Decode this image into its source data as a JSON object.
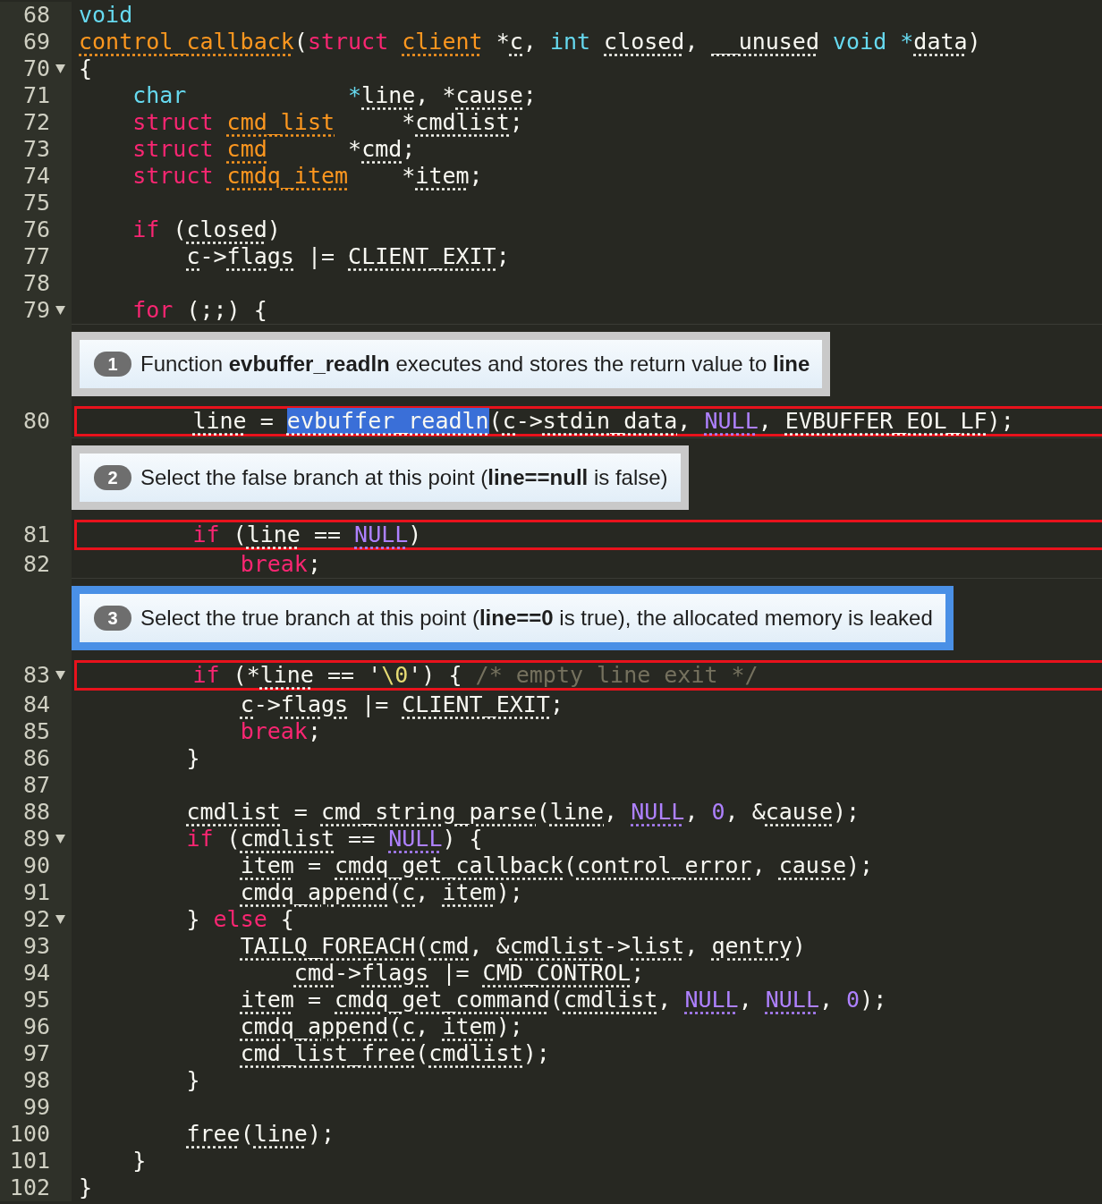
{
  "editor": {
    "lines": [
      {
        "kind": "code",
        "number": "68",
        "foldable": false,
        "marked": false,
        "tokens": [
          {
            "text": "void",
            "kind": "storage"
          }
        ]
      },
      {
        "kind": "code",
        "number": "69",
        "foldable": false,
        "marked": false,
        "tokens": [
          {
            "text": "control_callback",
            "kind": "fn"
          },
          {
            "text": "(",
            "kind": "plain"
          },
          {
            "text": "struct ",
            "kind": "kw"
          },
          {
            "text": "client",
            "kind": "type"
          },
          {
            "text": " *",
            "kind": "plain"
          },
          {
            "text": "c",
            "kind": "id"
          },
          {
            "text": ", ",
            "kind": "plain"
          },
          {
            "text": "int ",
            "kind": "storage"
          },
          {
            "text": "closed",
            "kind": "id"
          },
          {
            "text": ", ",
            "kind": "plain"
          },
          {
            "text": "__unused",
            "kind": "id"
          },
          {
            "text": " void *",
            "kind": "storage"
          },
          {
            "text": "data",
            "kind": "id"
          },
          {
            "text": ")",
            "kind": "plain"
          }
        ]
      },
      {
        "kind": "code",
        "number": "70",
        "foldable": true,
        "marked": false,
        "tokens": [
          {
            "text": "{",
            "kind": "plain"
          }
        ]
      },
      {
        "kind": "code",
        "number": "71",
        "foldable": false,
        "marked": false,
        "tokens": [
          {
            "text": "    char            *",
            "kind": "storage"
          },
          {
            "text": "line",
            "kind": "id"
          },
          {
            "text": ", *",
            "kind": "plain"
          },
          {
            "text": "cause",
            "kind": "id"
          },
          {
            "text": ";",
            "kind": "plain"
          }
        ]
      },
      {
        "kind": "code",
        "number": "72",
        "foldable": false,
        "marked": false,
        "tokens": [
          {
            "text": "    struct ",
            "kind": "kw"
          },
          {
            "text": "cmd_list",
            "kind": "type"
          },
          {
            "text": "     *",
            "kind": "plain"
          },
          {
            "text": "cmdlist",
            "kind": "id"
          },
          {
            "text": ";",
            "kind": "plain"
          }
        ]
      },
      {
        "kind": "code",
        "number": "73",
        "foldable": false,
        "marked": false,
        "tokens": [
          {
            "text": "    struct ",
            "kind": "kw"
          },
          {
            "text": "cmd",
            "kind": "type"
          },
          {
            "text": "      *",
            "kind": "plain"
          },
          {
            "text": "cmd",
            "kind": "id"
          },
          {
            "text": ";",
            "kind": "plain"
          }
        ]
      },
      {
        "kind": "code",
        "number": "74",
        "foldable": false,
        "marked": false,
        "tokens": [
          {
            "text": "    struct ",
            "kind": "kw"
          },
          {
            "text": "cmdq_item",
            "kind": "type"
          },
          {
            "text": "    *",
            "kind": "plain"
          },
          {
            "text": "item",
            "kind": "id"
          },
          {
            "text": ";",
            "kind": "plain"
          }
        ]
      },
      {
        "kind": "code",
        "number": "75",
        "foldable": false
      },
      {
        "kind": "code",
        "number": "76",
        "foldable": false,
        "marked": false,
        "tokens": [
          {
            "text": "    if",
            "kind": "kw"
          },
          {
            "text": " (",
            "kind": "plain"
          },
          {
            "text": "closed",
            "kind": "id"
          },
          {
            "text": ")",
            "kind": "plain"
          }
        ]
      },
      {
        "kind": "code",
        "number": "77",
        "foldable": false,
        "marked": false,
        "tokens": [
          {
            "text": "        c",
            "kind": "id"
          },
          {
            "text": "->",
            "kind": "plain"
          },
          {
            "text": "flags",
            "kind": "id"
          },
          {
            "text": " |= ",
            "kind": "plain"
          },
          {
            "text": "CLIENT_EXIT",
            "kind": "id"
          },
          {
            "text": ";",
            "kind": "plain"
          }
        ]
      },
      {
        "kind": "code",
        "number": "78",
        "foldable": false
      },
      {
        "kind": "code",
        "number": "79",
        "foldable": true,
        "marked": false,
        "tokens": [
          {
            "text": "    for",
            "kind": "kw"
          },
          {
            "text": " (;;) {",
            "kind": "plain"
          }
        ]
      },
      {
        "kind": "note",
        "step": "1",
        "selected": false,
        "text": "Function **evbuffer_readln** executes and stores the return value to **line**"
      },
      {
        "kind": "code",
        "number": "80",
        "foldable": false,
        "marked": true,
        "tokens": [
          {
            "text": "        line",
            "kind": "id"
          },
          {
            "text": " = ",
            "kind": "plain"
          },
          {
            "text": "evbuffer_readln",
            "kind": "sel"
          },
          {
            "text": "(",
            "kind": "plain"
          },
          {
            "text": "c",
            "kind": "id"
          },
          {
            "text": "->",
            "kind": "plain"
          },
          {
            "text": "stdin_data",
            "kind": "id"
          },
          {
            "text": ", ",
            "kind": "plain"
          },
          {
            "text": "NULL",
            "kind": "const"
          },
          {
            "text": ", ",
            "kind": "plain"
          },
          {
            "text": "EVBUFFER_EOL_LF",
            "kind": "id"
          },
          {
            "text": ");",
            "kind": "plain"
          }
        ]
      },
      {
        "kind": "note",
        "step": "2",
        "selected": false,
        "text": "Select the false branch at this point (**line==null** is false)"
      },
      {
        "kind": "code",
        "number": "81",
        "foldable": false,
        "marked": true,
        "tokens": [
          {
            "text": "        if",
            "kind": "kw"
          },
          {
            "text": " (",
            "kind": "plain"
          },
          {
            "text": "line",
            "kind": "id"
          },
          {
            "text": " == ",
            "kind": "plain"
          },
          {
            "text": "NULL",
            "kind": "const"
          },
          {
            "text": ")",
            "kind": "plain"
          }
        ]
      },
      {
        "kind": "code",
        "number": "82",
        "foldable": false,
        "marked": false,
        "tokens": [
          {
            "text": "            break",
            "kind": "kw"
          },
          {
            "text": ";",
            "kind": "plain"
          }
        ]
      },
      {
        "kind": "note",
        "step": "3",
        "selected": true,
        "text": "Select the true branch at this point (**line==0** is true), the allocated memory is leaked"
      },
      {
        "kind": "code",
        "number": "83",
        "foldable": true,
        "marked": true,
        "tokens": [
          {
            "text": "        if",
            "kind": "kw"
          },
          {
            "text": " (*",
            "kind": "plain"
          },
          {
            "text": "line",
            "kind": "id"
          },
          {
            "text": " == '",
            "kind": "plain"
          },
          {
            "text": "\\0",
            "kind": "str"
          },
          {
            "text": "') { ",
            "kind": "plain"
          },
          {
            "text": "/* empty line exit */",
            "kind": "comment"
          }
        ]
      },
      {
        "kind": "code",
        "number": "84",
        "foldable": false,
        "marked": false,
        "tokens": [
          {
            "text": "            c",
            "kind": "id"
          },
          {
            "text": "->",
            "kind": "plain"
          },
          {
            "text": "flags",
            "kind": "id"
          },
          {
            "text": " |= ",
            "kind": "plain"
          },
          {
            "text": "CLIENT_EXIT",
            "kind": "id"
          },
          {
            "text": ";",
            "kind": "plain"
          }
        ]
      },
      {
        "kind": "code",
        "number": "85",
        "foldable": false,
        "marked": false,
        "tokens": [
          {
            "text": "            break",
            "kind": "kw"
          },
          {
            "text": ";",
            "kind": "plain"
          }
        ]
      },
      {
        "kind": "code",
        "number": "86",
        "foldable": false,
        "marked": false,
        "tokens": [
          {
            "text": "        }",
            "kind": "plain"
          }
        ]
      },
      {
        "kind": "code",
        "number": "87",
        "foldable": false
      },
      {
        "kind": "code",
        "number": "88",
        "foldable": false,
        "marked": false,
        "tokens": [
          {
            "text": "        cmdlist",
            "kind": "id"
          },
          {
            "text": " = ",
            "kind": "plain"
          },
          {
            "text": "cmd_string_parse",
            "kind": "id"
          },
          {
            "text": "(",
            "kind": "plain"
          },
          {
            "text": "line",
            "kind": "id"
          },
          {
            "text": ", ",
            "kind": "plain"
          },
          {
            "text": "NULL",
            "kind": "const"
          },
          {
            "text": ", ",
            "kind": "plain"
          },
          {
            "text": "0",
            "kind": "num"
          },
          {
            "text": ", &",
            "kind": "plain"
          },
          {
            "text": "cause",
            "kind": "id"
          },
          {
            "text": ");",
            "kind": "plain"
          }
        ]
      },
      {
        "kind": "code",
        "number": "89",
        "foldable": true,
        "marked": false,
        "tokens": [
          {
            "text": "        if",
            "kind": "kw"
          },
          {
            "text": " (",
            "kind": "plain"
          },
          {
            "text": "cmdlist",
            "kind": "id"
          },
          {
            "text": " == ",
            "kind": "plain"
          },
          {
            "text": "NULL",
            "kind": "const"
          },
          {
            "text": ") {",
            "kind": "plain"
          }
        ]
      },
      {
        "kind": "code",
        "number": "90",
        "foldable": false,
        "marked": false,
        "tokens": [
          {
            "text": "            item",
            "kind": "id"
          },
          {
            "text": " = ",
            "kind": "plain"
          },
          {
            "text": "cmdq_get_callback",
            "kind": "id"
          },
          {
            "text": "(",
            "kind": "plain"
          },
          {
            "text": "control_error",
            "kind": "id"
          },
          {
            "text": ", ",
            "kind": "plain"
          },
          {
            "text": "cause",
            "kind": "id"
          },
          {
            "text": ");",
            "kind": "plain"
          }
        ]
      },
      {
        "kind": "code",
        "number": "91",
        "foldable": false,
        "marked": false,
        "tokens": [
          {
            "text": "            cmdq_append",
            "kind": "id"
          },
          {
            "text": "(",
            "kind": "plain"
          },
          {
            "text": "c",
            "kind": "id"
          },
          {
            "text": ", ",
            "kind": "plain"
          },
          {
            "text": "item",
            "kind": "id"
          },
          {
            "text": ");",
            "kind": "plain"
          }
        ]
      },
      {
        "kind": "code",
        "number": "92",
        "foldable": true,
        "marked": false,
        "tokens": [
          {
            "text": "        } ",
            "kind": "plain"
          },
          {
            "text": "else",
            "kind": "kw"
          },
          {
            "text": " {",
            "kind": "plain"
          }
        ]
      },
      {
        "kind": "code",
        "number": "93",
        "foldable": false,
        "marked": false,
        "tokens": [
          {
            "text": "            TAILQ_FOREACH",
            "kind": "id"
          },
          {
            "text": "(",
            "kind": "plain"
          },
          {
            "text": "cmd",
            "kind": "id"
          },
          {
            "text": ", &",
            "kind": "plain"
          },
          {
            "text": "cmdlist",
            "kind": "id"
          },
          {
            "text": "->",
            "kind": "plain"
          },
          {
            "text": "list",
            "kind": "id"
          },
          {
            "text": ", ",
            "kind": "plain"
          },
          {
            "text": "qentry",
            "kind": "id"
          },
          {
            "text": ")",
            "kind": "plain"
          }
        ]
      },
      {
        "kind": "code",
        "number": "94",
        "foldable": false,
        "marked": false,
        "tokens": [
          {
            "text": "                cmd",
            "kind": "id"
          },
          {
            "text": "->",
            "kind": "plain"
          },
          {
            "text": "flags",
            "kind": "id"
          },
          {
            "text": " |= ",
            "kind": "plain"
          },
          {
            "text": "CMD_CONTROL",
            "kind": "id"
          },
          {
            "text": ";",
            "kind": "plain"
          }
        ]
      },
      {
        "kind": "code",
        "number": "95",
        "foldable": false,
        "marked": false,
        "tokens": [
          {
            "text": "            item",
            "kind": "id"
          },
          {
            "text": " = ",
            "kind": "plain"
          },
          {
            "text": "cmdq_get_command",
            "kind": "id"
          },
          {
            "text": "(",
            "kind": "plain"
          },
          {
            "text": "cmdlist",
            "kind": "id"
          },
          {
            "text": ", ",
            "kind": "plain"
          },
          {
            "text": "NULL",
            "kind": "const"
          },
          {
            "text": ", ",
            "kind": "plain"
          },
          {
            "text": "NULL",
            "kind": "const"
          },
          {
            "text": ", ",
            "kind": "plain"
          },
          {
            "text": "0",
            "kind": "num"
          },
          {
            "text": ");",
            "kind": "plain"
          }
        ]
      },
      {
        "kind": "code",
        "number": "96",
        "foldable": false,
        "marked": false,
        "tokens": [
          {
            "text": "            cmdq_append",
            "kind": "id"
          },
          {
            "text": "(",
            "kind": "plain"
          },
          {
            "text": "c",
            "kind": "id"
          },
          {
            "text": ", ",
            "kind": "plain"
          },
          {
            "text": "item",
            "kind": "id"
          },
          {
            "text": ");",
            "kind": "plain"
          }
        ]
      },
      {
        "kind": "code",
        "number": "97",
        "foldable": false,
        "marked": false,
        "tokens": [
          {
            "text": "            cmd_list_free",
            "kind": "id"
          },
          {
            "text": "(",
            "kind": "plain"
          },
          {
            "text": "cmdlist",
            "kind": "id"
          },
          {
            "text": ");",
            "kind": "plain"
          }
        ]
      },
      {
        "kind": "code",
        "number": "98",
        "foldable": false,
        "marked": false,
        "tokens": [
          {
            "text": "        }",
            "kind": "plain"
          }
        ]
      },
      {
        "kind": "code",
        "number": "99",
        "foldable": false
      },
      {
        "kind": "code",
        "number": "100",
        "foldable": false,
        "marked": false,
        "tokens": [
          {
            "text": "        free",
            "kind": "id"
          },
          {
            "text": "(",
            "kind": "plain"
          },
          {
            "text": "line",
            "kind": "id"
          },
          {
            "text": ");",
            "kind": "plain"
          }
        ]
      },
      {
        "kind": "code",
        "number": "101",
        "foldable": false,
        "marked": false,
        "tokens": [
          {
            "text": "    }",
            "kind": "plain"
          }
        ]
      },
      {
        "kind": "code",
        "number": "102",
        "foldable": false,
        "marked": false,
        "tokens": [
          {
            "text": "}",
            "kind": "plain"
          }
        ]
      }
    ]
  }
}
